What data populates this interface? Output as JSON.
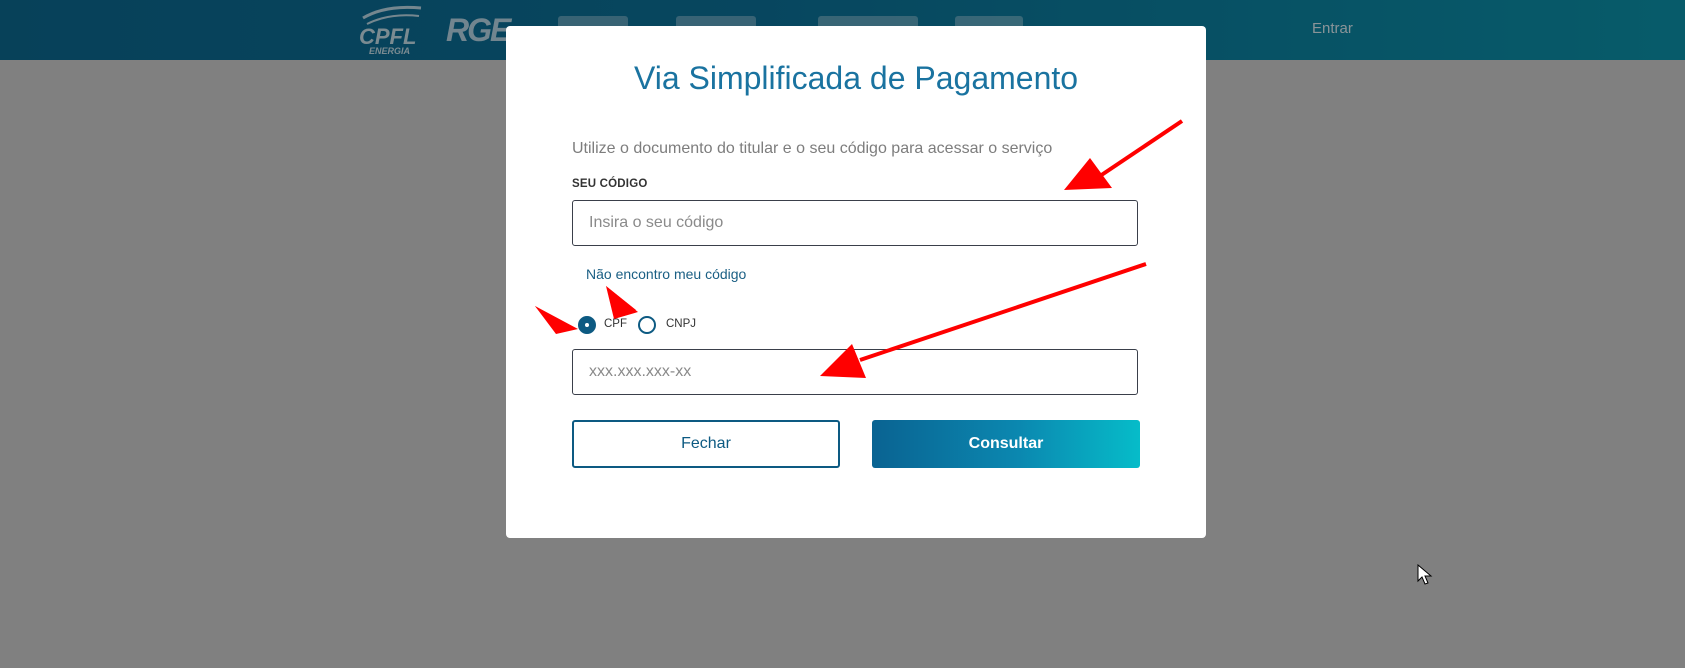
{
  "header": {
    "brand_cpfl": "CPFL",
    "brand_cpfl_sub": "ENERGIA",
    "brand_rge": "RGE",
    "login_label": "Entrar"
  },
  "modal": {
    "title": "Via Simplificada de Pagamento",
    "subtitle": "Utilize o documento do titular e o seu código para acessar o serviço",
    "code_label": "SEU CÓDIGO",
    "code_placeholder": "Insira o seu código",
    "forgot_code_link": "Não encontro meu código",
    "doc_types": [
      {
        "label": "CPF",
        "checked": true
      },
      {
        "label": "CNPJ",
        "checked": false
      }
    ],
    "doc_placeholder": "xxx.xxx.xxx-xx",
    "close_label": "Fechar",
    "submit_label": "Consultar"
  },
  "colors": {
    "accent": "#0d5a82",
    "annotation_arrow": "#ff0000",
    "overlay": "#808080"
  }
}
